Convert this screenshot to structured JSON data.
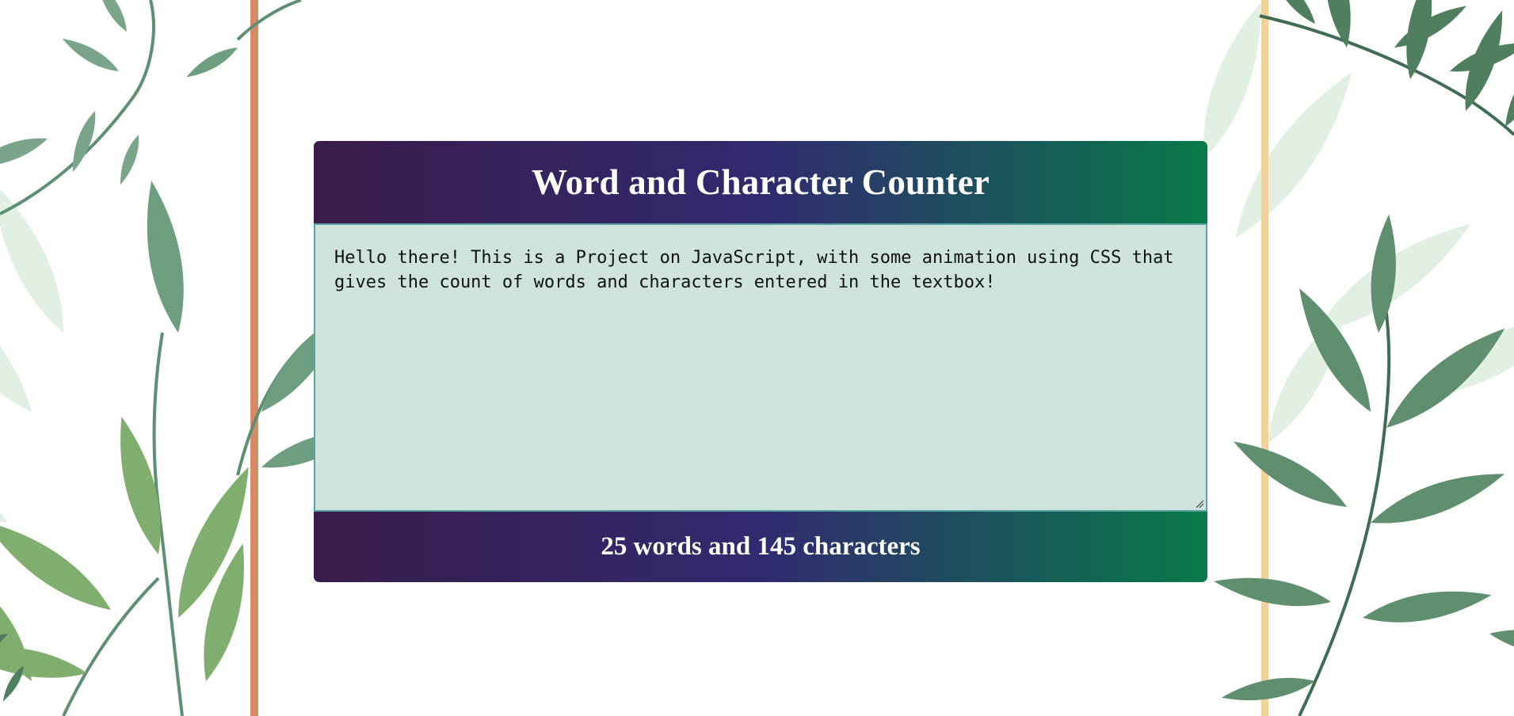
{
  "app": {
    "title": "Word and Character Counter"
  },
  "editor": {
    "value": "Hello there! This is a Project on JavaScript, with some animation using CSS that gives the count of words and characters entered in the textbox!"
  },
  "result": {
    "text": "25 words and 145 characters"
  },
  "colors": {
    "gradient_start": "#3a1c4a",
    "gradient_mid": "#312a70",
    "gradient_end": "#087a4a",
    "textarea_bg": "#cde3dc",
    "textarea_border": "#5aa3a3",
    "left_stripe": "#d68a66",
    "right_stripe": "#f2d29c"
  },
  "decor": {
    "background_icon": "watercolor-leaves-icon"
  }
}
